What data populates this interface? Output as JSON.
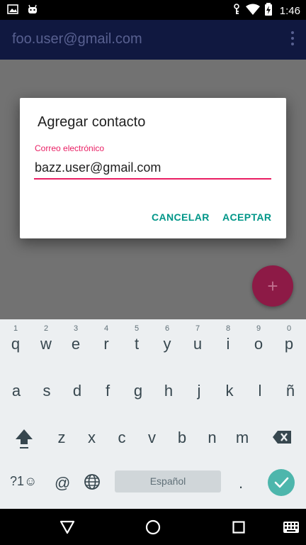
{
  "status_bar": {
    "time": "1:46"
  },
  "app_bar": {
    "title": "foo.user@gmail.com"
  },
  "dialog": {
    "title": "Agregar contacto",
    "field_label": "Correo electrónico",
    "field_value": "bazz.user@gmail.com",
    "cancel_label": "CANCELAR",
    "accept_label": "ACEPTAR"
  },
  "fab": {
    "label": "+"
  },
  "keyboard": {
    "row1": [
      {
        "key": "q",
        "hint": "1"
      },
      {
        "key": "w",
        "hint": "2"
      },
      {
        "key": "e",
        "hint": "3"
      },
      {
        "key": "r",
        "hint": "4"
      },
      {
        "key": "t",
        "hint": "5"
      },
      {
        "key": "y",
        "hint": "6"
      },
      {
        "key": "u",
        "hint": "7"
      },
      {
        "key": "i",
        "hint": "8"
      },
      {
        "key": "o",
        "hint": "9"
      },
      {
        "key": "p",
        "hint": "0"
      }
    ],
    "row2": [
      "a",
      "s",
      "d",
      "f",
      "g",
      "h",
      "j",
      "k",
      "l",
      "ñ"
    ],
    "row3": [
      "z",
      "x",
      "c",
      "v",
      "b",
      "n",
      "m"
    ],
    "symbols_label": "?1☺",
    "at_label": "@",
    "space_label": "Español",
    "period_label": "."
  },
  "colors": {
    "accent": "#e91e63",
    "button_text": "#009688",
    "app_bar": "#101840",
    "fab": "#8d1a46",
    "enter_key": "#4db6ac"
  },
  "icons": [
    "image-icon",
    "android-icon",
    "key-icon",
    "wifi-icon",
    "battery-icon",
    "overflow-menu-icon",
    "shift-icon",
    "backspace-icon",
    "globe-icon",
    "check-icon",
    "back-icon",
    "home-icon",
    "recents-icon",
    "keyboard-icon"
  ]
}
